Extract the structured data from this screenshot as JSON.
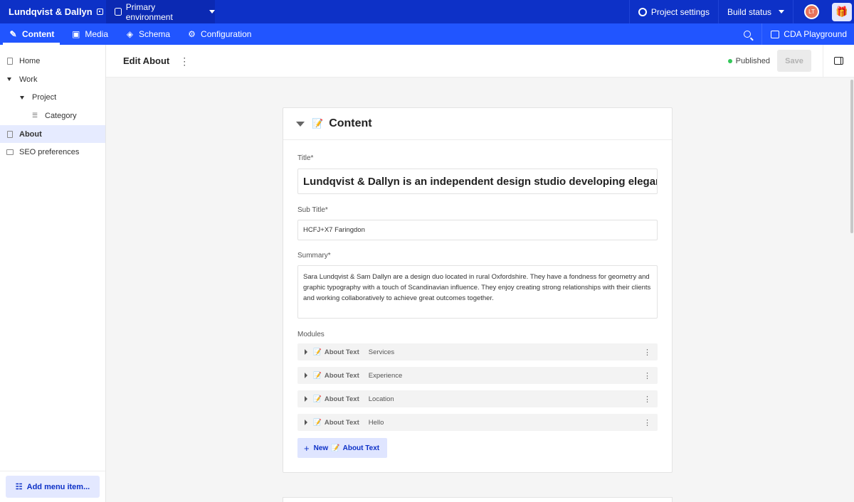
{
  "topbar": {
    "brand": "Lundqvist & Dallyn",
    "environment": "Primary environment",
    "project_settings": "Project settings",
    "build_status": "Build status",
    "avatar_initials": "LT"
  },
  "navbar": {
    "items": [
      {
        "label": "Content",
        "icon": "edit-icon",
        "active": true
      },
      {
        "label": "Media",
        "icon": "image-icon",
        "active": false
      },
      {
        "label": "Schema",
        "icon": "layers-icon",
        "active": false
      },
      {
        "label": "Configuration",
        "icon": "config-icon",
        "active": false
      }
    ],
    "cda_playground": "CDA Playground"
  },
  "sidebar": {
    "items": [
      {
        "label": "Home",
        "level": 0,
        "icon": "page-icon",
        "active": false
      },
      {
        "label": "Work",
        "level": 0,
        "icon": "expanded-caret-icon",
        "active": false
      },
      {
        "label": "Project",
        "level": 1,
        "icon": "expanded-caret-icon",
        "active": false
      },
      {
        "label": "Category",
        "level": 2,
        "icon": "list-icon",
        "active": false
      },
      {
        "label": "About",
        "level": 0,
        "icon": "page-icon",
        "active": true
      },
      {
        "label": "SEO preferences",
        "level": 0,
        "icon": "settings-icon",
        "active": false
      }
    ],
    "add_menu_item": "Add menu item..."
  },
  "header": {
    "title": "Edit About",
    "status": "Published",
    "save_label": "Save"
  },
  "content": {
    "section_title": "Content",
    "title_label": "Title*",
    "title_value": "Lundqvist & Dallyn is an independent design studio developing elegan",
    "subtitle_label": "Sub Title*",
    "subtitle_value": "HCFJ+X7 Faringdon",
    "summary_label": "Summary*",
    "summary_value": "Sara Lundqvist & Sam Dallyn are a design duo located in rural Oxfordshire. They have a fondness for geometry and graphic typography with a touch of Scandinavian influence. They enjoy creating strong relationships with their clients and working collaboratively to achieve great outcomes together.",
    "modules_label": "Modules",
    "modules": [
      {
        "type": "About Text",
        "name": "Services"
      },
      {
        "type": "About Text",
        "name": "Experience"
      },
      {
        "type": "About Text",
        "name": "Location"
      },
      {
        "type": "About Text",
        "name": "Hello"
      }
    ],
    "new_button_prefix": "New",
    "new_button_type": "About Text"
  },
  "colors": {
    "topbar": "#0d31c7",
    "navbar": "#2155ff",
    "accent_light": "#e3e8ff",
    "published_dot": "#34c759"
  }
}
